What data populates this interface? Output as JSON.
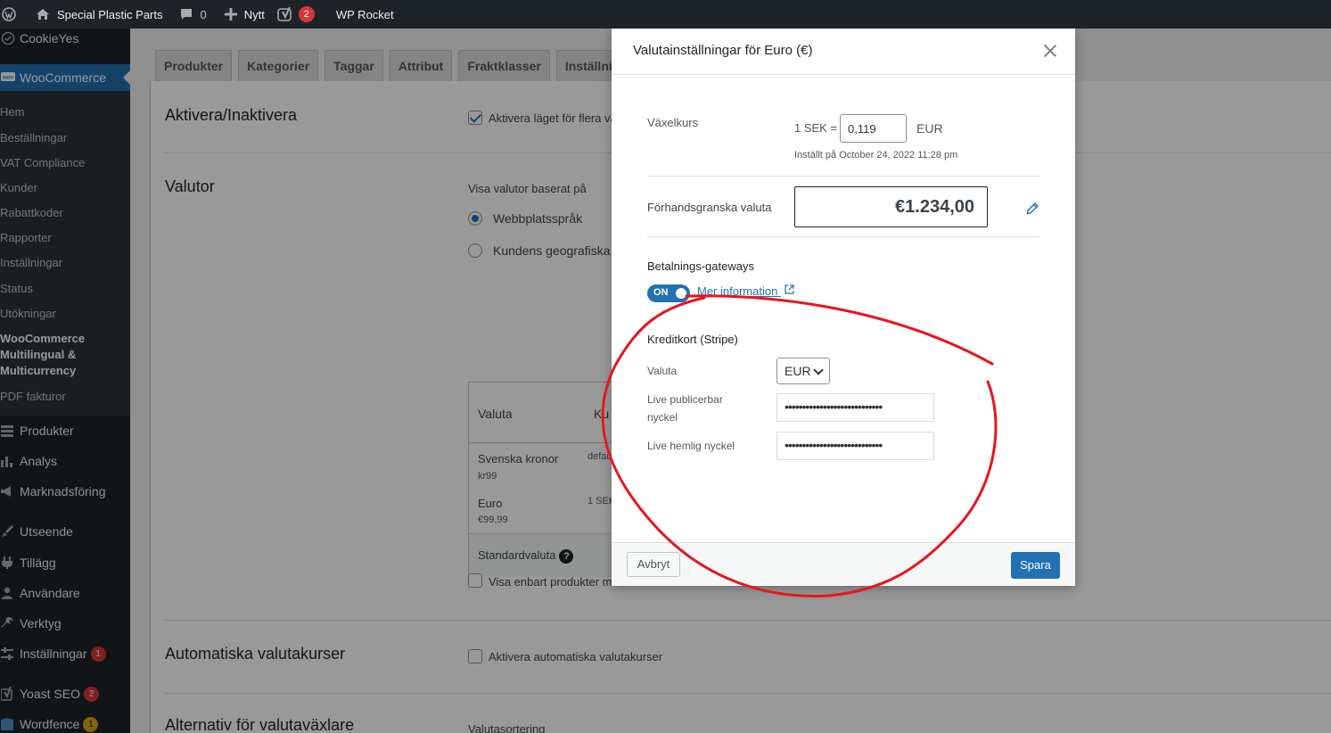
{
  "adminbar": {
    "site_name": "Special Plastic Parts",
    "comments_count": "0",
    "new_label": "Nytt",
    "yoast_count": "2",
    "rocket_label": "WP Rocket"
  },
  "sidebar": {
    "cookieyes": "CookieYes",
    "woocommerce": "WooCommerce",
    "woo_submenu": [
      "Hem",
      "Beställningar",
      "VAT Compliance",
      "Kunder",
      "Rabattkoder",
      "Rapporter",
      "Inställningar",
      "Status",
      "Utökningar"
    ],
    "woo_current": "WooCommerce Multilingual & Multicurrency",
    "pdf": "PDF fakturor",
    "produkter": "Produkter",
    "analys": "Analys",
    "marknadsforing": "Marknadsföring",
    "utseende": "Utseende",
    "tillagg": "Tillägg",
    "anvandare": "Användare",
    "verktyg": "Verktyg",
    "installningar": "Inställningar",
    "installningar_badge": "1",
    "yoast": "Yoast SEO",
    "yoast_badge": "2",
    "wordfence": "Wordfence",
    "wordfence_badge": "1"
  },
  "tabs": [
    "Produkter",
    "Kategorier",
    "Taggar",
    "Attribut",
    "Fraktklasser",
    "Inställnin"
  ],
  "main": {
    "enable_title": "Aktivera/Inaktivera",
    "enable_checkbox": "Aktivera läget för flera va",
    "currencies_title": "Valutor",
    "show_based_on": "Visa valutor baserat på",
    "radio_site_lang": "Webbplatsspråk",
    "radio_geo": "Kundens geografiska",
    "table_col_currency": "Valuta",
    "table_col_rate": "Ku",
    "row1_name": "Svenska kronor",
    "row1_sub": "kr99",
    "row1_rate": "defau",
    "row2_name": "Euro",
    "row2_sub": "€99,99",
    "row2_rate": "1 SEK",
    "default_currency": "Standardvaluta",
    "show_only_products": "Visa enbart produkter m",
    "auto_rates_title": "Automatiska valutakurser",
    "auto_rates_checkbox": "Aktivera automatiska valutakurser",
    "switcher_title": "Alternativ för valutaväxlare",
    "sorting_label": "Valutasortering"
  },
  "modal": {
    "title": "Valutainställningar för Euro (€)",
    "rate_label": "Växelkurs",
    "rate_prefix": "1 SEK =",
    "rate_value": "0,119",
    "rate_suffix": "EUR",
    "rate_set_at": "Inställt på October 24, 2022 11:28 pm",
    "preview_label": "Förhandsgranska valuta",
    "preview_value": "€1.234,00",
    "gateways_title": "Betalnings-gateways",
    "toggle_label": "ON",
    "more_info": "Mer information",
    "stripe_title": "Kreditkort (Stripe)",
    "currency_label": "Valuta",
    "currency_value": "EUR",
    "live_pub_label_1": "Live publicerbar",
    "live_pub_label_2": "nyckel",
    "live_pub_value": "••••••••••••••••••••••••••••",
    "live_secret_label": "Live hemlig nyckel",
    "live_secret_value": "••••••••••••••••••••••••••••",
    "cancel": "Avbryt",
    "save": "Spara"
  },
  "colors": {
    "accent": "#2271b1",
    "annotation": "#e8141e"
  }
}
